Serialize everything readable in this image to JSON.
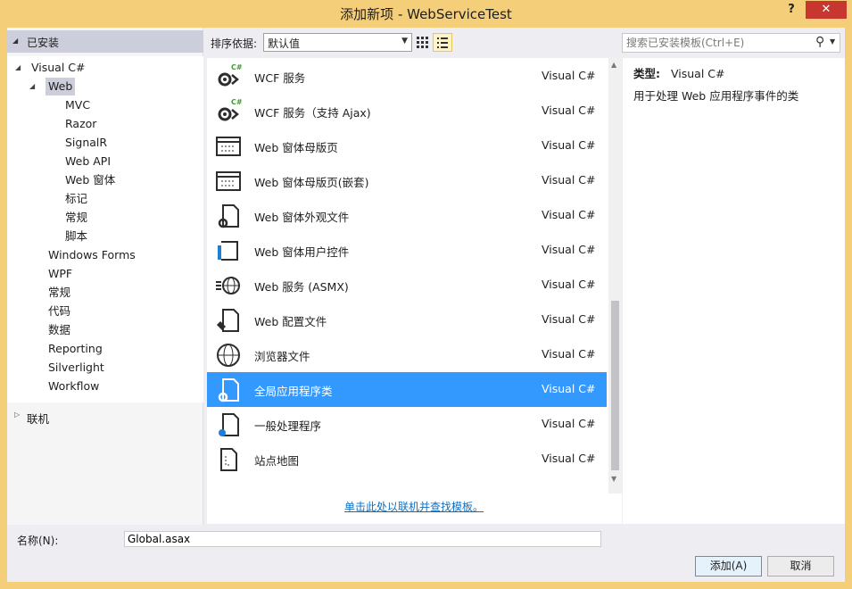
{
  "window": {
    "title": "添加新项 - WebServiceTest",
    "help_label": "?",
    "close_label": "✕"
  },
  "tree": {
    "header_label": "已安装",
    "nodes": [
      {
        "label": "Visual C#",
        "level": 1,
        "expanded": true
      },
      {
        "label": "Web",
        "level": 2,
        "expanded": true,
        "selected": true
      },
      {
        "label": "MVC",
        "level": 3
      },
      {
        "label": "Razor",
        "level": 3
      },
      {
        "label": "SignalR",
        "level": 3
      },
      {
        "label": "Web API",
        "level": 3
      },
      {
        "label": "Web 窗体",
        "level": 3
      },
      {
        "label": "标记",
        "level": 3
      },
      {
        "label": "常规",
        "level": 3
      },
      {
        "label": "脚本",
        "level": 3
      },
      {
        "label": "Windows Forms",
        "level": 2
      },
      {
        "label": "WPF",
        "level": 2
      },
      {
        "label": "常规",
        "level": 2
      },
      {
        "label": "代码",
        "level": 2
      },
      {
        "label": "数据",
        "level": 2
      },
      {
        "label": "Reporting",
        "level": 2
      },
      {
        "label": "Silverlight",
        "level": 2
      },
      {
        "label": "Workflow",
        "level": 2
      }
    ],
    "online_label": "联机"
  },
  "toolbar": {
    "sort_label": "排序依据:",
    "sort_value": "默认值"
  },
  "search": {
    "placeholder": "搜索已安装模板(Ctrl+E)"
  },
  "templates": {
    "items": [
      {
        "name": "WCF 服务",
        "lang": "Visual C#",
        "icon": "wcf-service-icon"
      },
      {
        "name": "WCF 服务（支持 Ajax)",
        "lang": "Visual C#",
        "icon": "wcf-ajax-service-icon"
      },
      {
        "name": "Web 窗体母版页",
        "lang": "Visual C#",
        "icon": "master-page-icon"
      },
      {
        "name": "Web 窗体母版页(嵌套)",
        "lang": "Visual C#",
        "icon": "nested-master-page-icon"
      },
      {
        "name": "Web 窗体外观文件",
        "lang": "Visual C#",
        "icon": "skin-file-icon"
      },
      {
        "name": "Web 窗体用户控件",
        "lang": "Visual C#",
        "icon": "user-control-icon"
      },
      {
        "name": "Web 服务 (ASMX)",
        "lang": "Visual C#",
        "icon": "web-service-icon"
      },
      {
        "name": "Web 配置文件",
        "lang": "Visual C#",
        "icon": "web-config-icon"
      },
      {
        "name": "浏览器文件",
        "lang": "Visual C#",
        "icon": "browser-file-icon"
      },
      {
        "name": "全局应用程序类",
        "lang": "Visual C#",
        "icon": "global-app-class-icon",
        "selected": true
      },
      {
        "name": "一般处理程序",
        "lang": "Visual C#",
        "icon": "generic-handler-icon"
      },
      {
        "name": "站点地图",
        "lang": "Visual C#",
        "icon": "site-map-icon"
      }
    ],
    "online_link": "单击此处以联机并查找模板。"
  },
  "info": {
    "type_label": "类型:",
    "type_value": "Visual C#",
    "description": "用于处理 Web 应用程序事件的类"
  },
  "bottom": {
    "name_label": "名称(N):",
    "name_value": "Global.asax",
    "add_label": "添加(A)",
    "cancel_label": "取消"
  },
  "colors": {
    "selection": "#3399ff",
    "title_bar": "#f5ce7a",
    "close_button": "#c7372f",
    "link": "#0e70c0"
  }
}
